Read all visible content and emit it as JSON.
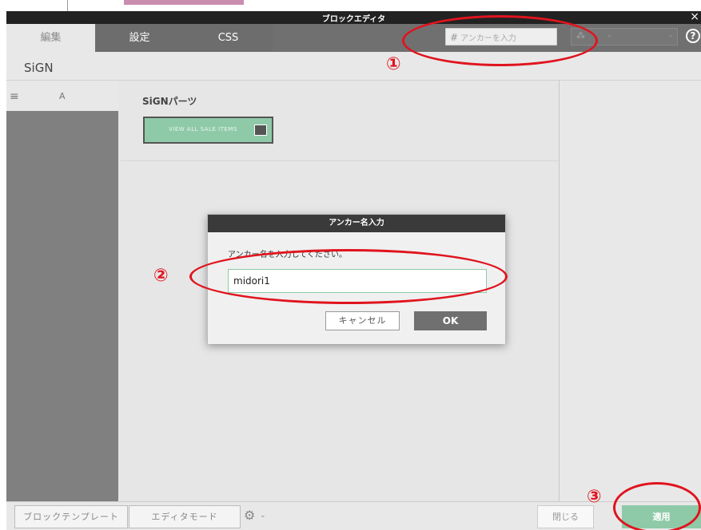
{
  "window": {
    "title": "ブロックエディタ",
    "close_glyph": "×"
  },
  "tabs": [
    {
      "label": "編集"
    },
    {
      "label": "設定"
    },
    {
      "label": "CSS"
    }
  ],
  "anchor": {
    "hash": "#",
    "placeholder": "アンカーを入力"
  },
  "help": {
    "glyph": "?"
  },
  "header": {
    "label": "SiGN"
  },
  "sidebar": {
    "a_label": "A"
  },
  "parts": {
    "title": "SiGNパーツ",
    "button_text": "VIEW ALL SALE ITEMS"
  },
  "dialog": {
    "title": "アンカー名入力",
    "prompt": "アンカー名を入力してください。",
    "input_value": "midori1",
    "cancel_label": "キャンセル",
    "ok_label": "OK"
  },
  "bottom": {
    "template_label": "ブロックテンプレート",
    "mode_label": "エディタモード",
    "close_label": "閉じる",
    "apply_label": "適用"
  },
  "annotations": {
    "n1": "①",
    "n2": "②",
    "n3": "③"
  },
  "colors": {
    "accent_green": "#8fcaa8",
    "annotation_red": "#e0141e",
    "titlebar": "#222222"
  }
}
